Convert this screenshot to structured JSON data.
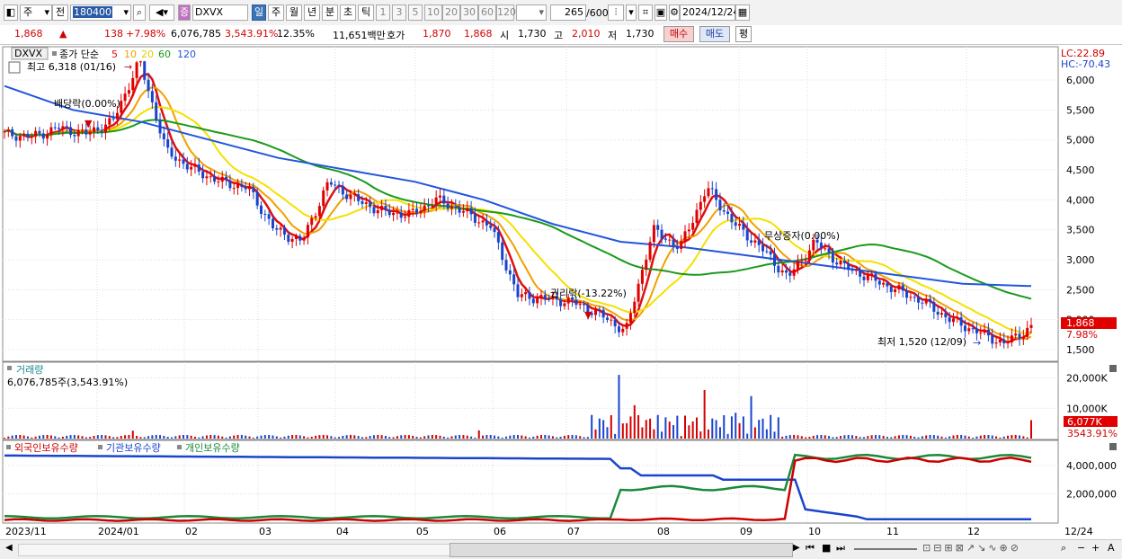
{
  "toolbar": {
    "period_type": "주",
    "prev_label": "전",
    "code": "180400",
    "name": "DXVX",
    "tabs": [
      "일",
      "주",
      "월",
      "년",
      "분",
      "초",
      "틱"
    ],
    "nums": [
      "1",
      "3",
      "5",
      "10",
      "20",
      "30",
      "60",
      "120"
    ],
    "count": "265",
    "total": "/600",
    "date": "2024/12/24"
  },
  "quote": {
    "price": "1,868",
    "arrow": "▲",
    "change": "138",
    "pct": "+7.98%",
    "volume": "6,076,785",
    "vol_ratio": "3,543.91%",
    "turnover": "12.35%",
    "amount": "11,651백만",
    "ask_label": "호가",
    "ask1": "1,870",
    "ask2": "1,868",
    "open_label": "시",
    "open": "1,730",
    "high_label": "고",
    "high": "2,010",
    "low_label": "저",
    "low": "1,730",
    "buy_label": "매수",
    "sell_label": "매도",
    "avg_label": "평"
  },
  "price_panel": {
    "symbol": "DXVX",
    "legend_prefix": "종가 단순",
    "ma_periods": [
      "5",
      "10",
      "20",
      "60",
      "120"
    ],
    "ma_colors": [
      "#e01010",
      "#f0a000",
      "#f5e000",
      "#1a9a1a",
      "#2255dd"
    ],
    "high_note": "최고 6,318 (01/16)",
    "low_note": "최저 1,520 (12/09)",
    "ann_dividend": "배당락(0.00%)",
    "ann_rights": "권리락(-13.22%)",
    "ann_bonus": "무상증자(0.00%)",
    "lc": "LC:22.89",
    "hc": "HC:-70.43",
    "price_tag": "1,868",
    "pct_tag": "7.98%",
    "yticks": [
      "6,000",
      "5,500",
      "5,000",
      "4,500",
      "4,000",
      "3,500",
      "3,000",
      "2,500",
      "2,000",
      "1,500"
    ]
  },
  "volume_panel": {
    "title": "거래량",
    "value": "6,076,785주(3,543.91%)",
    "yticks": [
      "20,000K",
      "10,000K"
    ],
    "tag": "6,077K",
    "tag2": "3543.91%"
  },
  "holding_panel": {
    "legend": [
      "외국인보유수량",
      "기관보유수량",
      "개인보유수량"
    ],
    "legend_colors": [
      "#cc0000",
      "#1a44cc",
      "#1a8a3a"
    ],
    "yticks": [
      "4,000,000",
      "2,000,000"
    ]
  },
  "xaxis": {
    "labels": [
      "2023/11",
      "2024/01",
      "02",
      "03",
      "04",
      "05",
      "06",
      "07",
      "08",
      "09",
      "10",
      "11",
      "12"
    ],
    "right_label": "12/24"
  },
  "chart_data": {
    "type": "candlestick",
    "ylim": [
      1500,
      6318
    ],
    "months": [
      "2023/11",
      "2024/01",
      "02",
      "03",
      "04",
      "05",
      "06",
      "07",
      "08",
      "09",
      "10",
      "11",
      "12"
    ],
    "approx_close_path": [
      5100,
      5050,
      5200,
      5100,
      5300,
      6318,
      4800,
      4500,
      4300,
      4200,
      3500,
      3300,
      4300,
      4000,
      3800,
      3750,
      4000,
      3800,
      3550,
      2400,
      2350,
      2300,
      2100,
      1800,
      3500,
      3200,
      4200,
      3600,
      3200,
      2700,
      3300,
      2900,
      2700,
      2500,
      2300,
      2000,
      1800,
      1600,
      1868
    ],
    "ma120_approx": [
      5900,
      5500,
      5300,
      5000,
      4700,
      4500,
      4300,
      4000,
      3600,
      3300,
      3200,
      3050,
      2900,
      2750,
      2600,
      2560
    ],
    "volume_peaks_k": [
      {
        "month": "07",
        "value": 21000
      },
      {
        "month": "08",
        "value": 16000
      },
      {
        "month": "09",
        "value": 14000
      }
    ],
    "last": {
      "price": 1868,
      "change": 138,
      "pct": 7.98,
      "volume": 6076785
    }
  }
}
